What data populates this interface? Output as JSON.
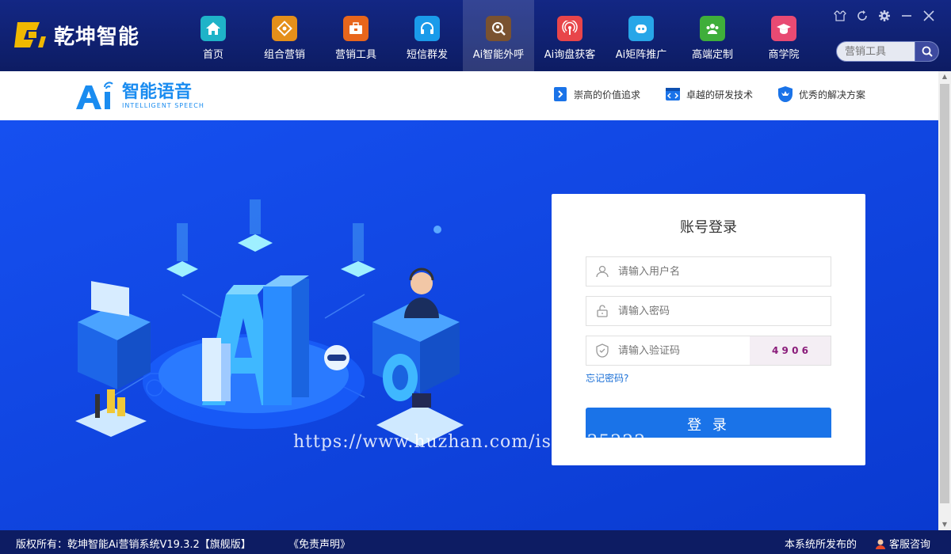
{
  "app": {
    "logo_text": "乾坤智能"
  },
  "nav": [
    {
      "label": "首页",
      "icon": "home-icon",
      "color": "#1fb3c8"
    },
    {
      "label": "组合营销",
      "icon": "combo-marketing-icon",
      "color": "#e48f1a"
    },
    {
      "label": "营销工具",
      "icon": "toolbox-icon",
      "color": "#e8661c"
    },
    {
      "label": "短信群发",
      "icon": "headset-icon",
      "color": "#1a9bea"
    },
    {
      "label": "Ai智能外呼",
      "icon": "search-person-icon",
      "color": "#7a5230"
    },
    {
      "label": "Ai询盘获客",
      "icon": "broadcast-icon",
      "color": "#e8454a"
    },
    {
      "label": "Ai矩阵推广",
      "icon": "robot-icon",
      "color": "#27a6e8"
    },
    {
      "label": "高端定制",
      "icon": "group-icon",
      "color": "#3fae3a"
    },
    {
      "label": "商学院",
      "icon": "graduation-cap-icon",
      "color": "#e84a73"
    }
  ],
  "search": {
    "placeholder": "营销工具"
  },
  "brand": {
    "ai": "Ai",
    "cn": "智能语音",
    "en": "INTELLIGENT SPEECH"
  },
  "features": [
    {
      "label": "崇高的价值追求",
      "icon": "arrow-doc-icon"
    },
    {
      "label": "卓越的研发技术",
      "icon": "code-icon"
    },
    {
      "label": "优秀的解决方案",
      "icon": "crown-shield-icon"
    }
  ],
  "login": {
    "title": "账号登录",
    "username_placeholder": "请输入用户名",
    "password_placeholder": "请输入密码",
    "captcha_placeholder": "请输入验证码",
    "captcha_text": "4 9 0 6",
    "forgot": "忘记密码?",
    "submit": "登 录"
  },
  "watermark": "https://www.huzhan.com/ishop35222",
  "footer": {
    "copyright": "版权所有：乾坤智能Ai营销系统V19.3.2【旗舰版】",
    "disclaimer": "《免责声明》",
    "notice": "本系统所发布的",
    "service": "客服咨询"
  }
}
